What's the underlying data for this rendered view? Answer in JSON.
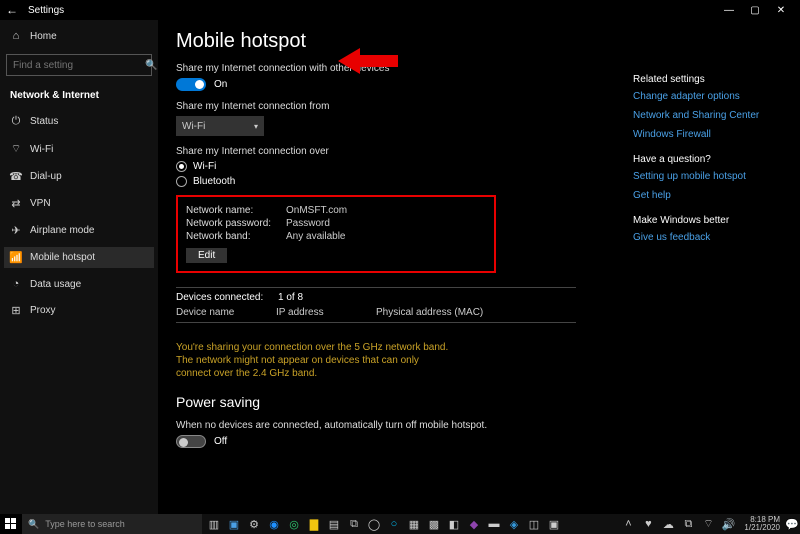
{
  "window": {
    "app": "Settings",
    "min": "—",
    "max": "▢",
    "close": "✕"
  },
  "sidebar": {
    "home": "Home",
    "search_placeholder": "Find a setting",
    "section": "Network & Internet",
    "items": [
      {
        "icon": "⏻",
        "label": "Status"
      },
      {
        "icon": "⌔",
        "label": "Wi-Fi"
      },
      {
        "icon": "☎",
        "label": "Dial-up"
      },
      {
        "icon": "⇄",
        "label": "VPN"
      },
      {
        "icon": "✈",
        "label": "Airplane mode"
      },
      {
        "icon": "📶",
        "label": "Mobile hotspot"
      },
      {
        "icon": "◔",
        "label": "Data usage"
      },
      {
        "icon": "⊞",
        "label": "Proxy"
      }
    ]
  },
  "page": {
    "title": "Mobile hotspot",
    "share_label": "Share my Internet connection with other devices",
    "share_state": "On",
    "from_label": "Share my Internet connection from",
    "from_value": "Wi-Fi",
    "over_label": "Share my Internet connection over",
    "over_options": [
      "Wi-Fi",
      "Bluetooth"
    ],
    "over_selected": "Wi-Fi",
    "net": {
      "name_k": "Network name:",
      "name_v": "OnMSFT.com",
      "pass_k": "Network password:",
      "pass_v": "Password",
      "band_k": "Network band:",
      "band_v": "Any available",
      "edit": "Edit"
    },
    "devices_k": "Devices connected:",
    "devices_v": "1 of 8",
    "cols": [
      "Device name",
      "IP address",
      "Physical address (MAC)"
    ],
    "note": "You're sharing your connection over the 5 GHz network band. The network might not appear on devices that can only connect over the 2.4 GHz band.",
    "power_title": "Power saving",
    "power_label": "When no devices are connected, automatically turn off mobile hotspot.",
    "power_state": "Off"
  },
  "right": {
    "related_h": "Related settings",
    "related": [
      "Change adapter options",
      "Network and Sharing Center",
      "Windows Firewall"
    ],
    "question_h": "Have a question?",
    "question": [
      "Setting up mobile hotspot",
      "Get help"
    ],
    "better_h": "Make Windows better",
    "better": [
      "Give us feedback"
    ]
  },
  "taskbar": {
    "search": "Type here to search",
    "time": "8:18 PM",
    "date": "1/21/2020"
  }
}
